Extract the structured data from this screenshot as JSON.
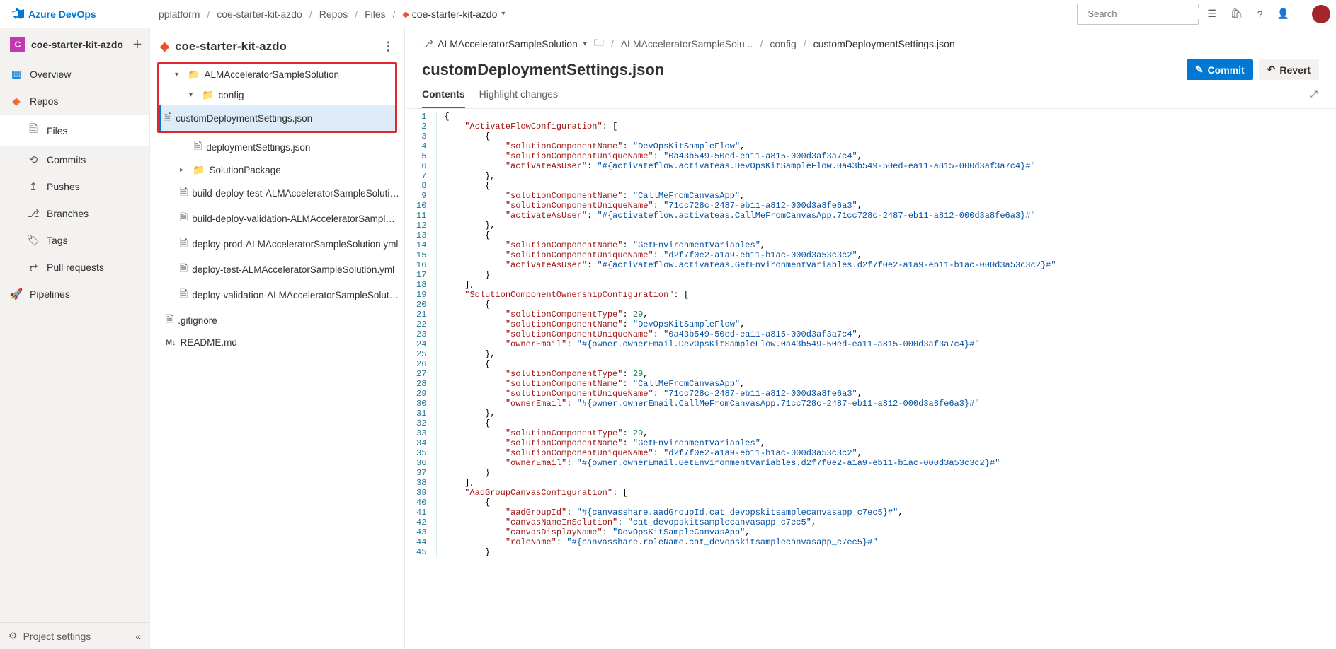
{
  "header": {
    "product": "Azure DevOps",
    "breadcrumbs": [
      "pplatform",
      "coe-starter-kit-azdo",
      "Repos",
      "Files",
      "coe-starter-kit-azdo"
    ],
    "search_placeholder": "Search"
  },
  "leftnav": {
    "project_badge": "C",
    "project_name": "coe-starter-kit-azdo",
    "items": [
      {
        "label": "Overview"
      },
      {
        "label": "Repos"
      },
      {
        "label": "Files",
        "sub": true,
        "selected": true
      },
      {
        "label": "Commits",
        "sub": true
      },
      {
        "label": "Pushes",
        "sub": true
      },
      {
        "label": "Branches",
        "sub": true
      },
      {
        "label": "Tags",
        "sub": true
      },
      {
        "label": "Pull requests",
        "sub": true
      },
      {
        "label": "Pipelines"
      }
    ],
    "settings": "Project settings"
  },
  "tree": {
    "repo": "coe-starter-kit-azdo",
    "folder1": "ALMAcceleratorSampleSolution",
    "folder2": "config",
    "file_selected": "customDeploymentSettings.json",
    "file_b": "deploymentSettings.json",
    "folder3": "SolutionPackage",
    "file_c": "build-deploy-test-ALMAcceleratorSampleSolutio...",
    "file_d": "build-deploy-validation-ALMAcceleratorSampleS...",
    "file_e": "deploy-prod-ALMAcceleratorSampleSolution.yml",
    "file_f": "deploy-test-ALMAcceleratorSampleSolution.yml",
    "file_g": "deploy-validation-ALMAcceleratorSampleSolutio...",
    "file_h": ".gitignore",
    "file_i": "README.md"
  },
  "content": {
    "branch": "ALMAcceleratorSampleSolution",
    "path1": "ALMAcceleratorSampleSolu...",
    "path2": "config",
    "path3": "customDeploymentSettings.json",
    "title": "customDeploymentSettings.json",
    "commit": "Commit",
    "revert": "Revert",
    "tab_contents": "Contents",
    "tab_highlight": "Highlight changes"
  },
  "code_lines": [
    [
      [
        "brace",
        "{"
      ]
    ],
    [
      [
        "sp",
        "    "
      ],
      [
        "key",
        "\"ActivateFlowConfiguration\""
      ],
      [
        "punc",
        ": ["
      ]
    ],
    [
      [
        "sp",
        "        "
      ],
      [
        "brace",
        "{"
      ]
    ],
    [
      [
        "sp",
        "            "
      ],
      [
        "key",
        "\"solutionComponentName\""
      ],
      [
        "punc",
        ": "
      ],
      [
        "str",
        "\"DevOpsKitSampleFlow\""
      ],
      [
        "punc",
        ","
      ]
    ],
    [
      [
        "sp",
        "            "
      ],
      [
        "key",
        "\"solutionComponentUniqueName\""
      ],
      [
        "punc",
        ": "
      ],
      [
        "str",
        "\"0a43b549-50ed-ea11-a815-000d3af3a7c4\""
      ],
      [
        "punc",
        ","
      ]
    ],
    [
      [
        "sp",
        "            "
      ],
      [
        "key",
        "\"activateAsUser\""
      ],
      [
        "punc",
        ": "
      ],
      [
        "str",
        "\"#{activateflow.activateas.DevOpsKitSampleFlow.0a43b549-50ed-ea11-a815-000d3af3a7c4}#\""
      ]
    ],
    [
      [
        "sp",
        "        "
      ],
      [
        "brace",
        "},"
      ]
    ],
    [
      [
        "sp",
        "        "
      ],
      [
        "brace",
        "{"
      ]
    ],
    [
      [
        "sp",
        "            "
      ],
      [
        "key",
        "\"solutionComponentName\""
      ],
      [
        "punc",
        ": "
      ],
      [
        "str",
        "\"CallMeFromCanvasApp\""
      ],
      [
        "punc",
        ","
      ]
    ],
    [
      [
        "sp",
        "            "
      ],
      [
        "key",
        "\"solutionComponentUniqueName\""
      ],
      [
        "punc",
        ": "
      ],
      [
        "str",
        "\"71cc728c-2487-eb11-a812-000d3a8fe6a3\""
      ],
      [
        "punc",
        ","
      ]
    ],
    [
      [
        "sp",
        "            "
      ],
      [
        "key",
        "\"activateAsUser\""
      ],
      [
        "punc",
        ": "
      ],
      [
        "str",
        "\"#{activateflow.activateas.CallMeFromCanvasApp.71cc728c-2487-eb11-a812-000d3a8fe6a3}#\""
      ]
    ],
    [
      [
        "sp",
        "        "
      ],
      [
        "brace",
        "},"
      ]
    ],
    [
      [
        "sp",
        "        "
      ],
      [
        "brace",
        "{"
      ]
    ],
    [
      [
        "sp",
        "            "
      ],
      [
        "key",
        "\"solutionComponentName\""
      ],
      [
        "punc",
        ": "
      ],
      [
        "str",
        "\"GetEnvironmentVariables\""
      ],
      [
        "punc",
        ","
      ]
    ],
    [
      [
        "sp",
        "            "
      ],
      [
        "key",
        "\"solutionComponentUniqueName\""
      ],
      [
        "punc",
        ": "
      ],
      [
        "str",
        "\"d2f7f0e2-a1a9-eb11-b1ac-000d3a53c3c2\""
      ],
      [
        "punc",
        ","
      ]
    ],
    [
      [
        "sp",
        "            "
      ],
      [
        "key",
        "\"activateAsUser\""
      ],
      [
        "punc",
        ": "
      ],
      [
        "str",
        "\"#{activateflow.activateas.GetEnvironmentVariables.d2f7f0e2-a1a9-eb11-b1ac-000d3a53c3c2}#\""
      ]
    ],
    [
      [
        "sp",
        "        "
      ],
      [
        "brace",
        "}"
      ]
    ],
    [
      [
        "sp",
        "    "
      ],
      [
        "punc",
        "],"
      ]
    ],
    [
      [
        "sp",
        "    "
      ],
      [
        "key",
        "\"SolutionComponentOwnershipConfiguration\""
      ],
      [
        "punc",
        ": ["
      ]
    ],
    [
      [
        "sp",
        "        "
      ],
      [
        "brace",
        "{"
      ]
    ],
    [
      [
        "sp",
        "            "
      ],
      [
        "key",
        "\"solutionComponentType\""
      ],
      [
        "punc",
        ": "
      ],
      [
        "num",
        "29"
      ],
      [
        "punc",
        ","
      ]
    ],
    [
      [
        "sp",
        "            "
      ],
      [
        "key",
        "\"solutionComponentName\""
      ],
      [
        "punc",
        ": "
      ],
      [
        "str",
        "\"DevOpsKitSampleFlow\""
      ],
      [
        "punc",
        ","
      ]
    ],
    [
      [
        "sp",
        "            "
      ],
      [
        "key",
        "\"solutionComponentUniqueName\""
      ],
      [
        "punc",
        ": "
      ],
      [
        "str",
        "\"0a43b549-50ed-ea11-a815-000d3af3a7c4\""
      ],
      [
        "punc",
        ","
      ]
    ],
    [
      [
        "sp",
        "            "
      ],
      [
        "key",
        "\"ownerEmail\""
      ],
      [
        "punc",
        ": "
      ],
      [
        "str",
        "\"#{owner.ownerEmail.DevOpsKitSampleFlow.0a43b549-50ed-ea11-a815-000d3af3a7c4}#\""
      ]
    ],
    [
      [
        "sp",
        "        "
      ],
      [
        "brace",
        "},"
      ]
    ],
    [
      [
        "sp",
        "        "
      ],
      [
        "brace",
        "{"
      ]
    ],
    [
      [
        "sp",
        "            "
      ],
      [
        "key",
        "\"solutionComponentType\""
      ],
      [
        "punc",
        ": "
      ],
      [
        "num",
        "29"
      ],
      [
        "punc",
        ","
      ]
    ],
    [
      [
        "sp",
        "            "
      ],
      [
        "key",
        "\"solutionComponentName\""
      ],
      [
        "punc",
        ": "
      ],
      [
        "str",
        "\"CallMeFromCanvasApp\""
      ],
      [
        "punc",
        ","
      ]
    ],
    [
      [
        "sp",
        "            "
      ],
      [
        "key",
        "\"solutionComponentUniqueName\""
      ],
      [
        "punc",
        ": "
      ],
      [
        "str",
        "\"71cc728c-2487-eb11-a812-000d3a8fe6a3\""
      ],
      [
        "punc",
        ","
      ]
    ],
    [
      [
        "sp",
        "            "
      ],
      [
        "key",
        "\"ownerEmail\""
      ],
      [
        "punc",
        ": "
      ],
      [
        "str",
        "\"#{owner.ownerEmail.CallMeFromCanvasApp.71cc728c-2487-eb11-a812-000d3a8fe6a3}#\""
      ]
    ],
    [
      [
        "sp",
        "        "
      ],
      [
        "brace",
        "},"
      ]
    ],
    [
      [
        "sp",
        "        "
      ],
      [
        "brace",
        "{"
      ]
    ],
    [
      [
        "sp",
        "            "
      ],
      [
        "key",
        "\"solutionComponentType\""
      ],
      [
        "punc",
        ": "
      ],
      [
        "num",
        "29"
      ],
      [
        "punc",
        ","
      ]
    ],
    [
      [
        "sp",
        "            "
      ],
      [
        "key",
        "\"solutionComponentName\""
      ],
      [
        "punc",
        ": "
      ],
      [
        "str",
        "\"GetEnvironmentVariables\""
      ],
      [
        "punc",
        ","
      ]
    ],
    [
      [
        "sp",
        "            "
      ],
      [
        "key",
        "\"solutionComponentUniqueName\""
      ],
      [
        "punc",
        ": "
      ],
      [
        "str",
        "\"d2f7f0e2-a1a9-eb11-b1ac-000d3a53c3c2\""
      ],
      [
        "punc",
        ","
      ]
    ],
    [
      [
        "sp",
        "            "
      ],
      [
        "key",
        "\"ownerEmail\""
      ],
      [
        "punc",
        ": "
      ],
      [
        "str",
        "\"#{owner.ownerEmail.GetEnvironmentVariables.d2f7f0e2-a1a9-eb11-b1ac-000d3a53c3c2}#\""
      ]
    ],
    [
      [
        "sp",
        "        "
      ],
      [
        "brace",
        "}"
      ]
    ],
    [
      [
        "sp",
        "    "
      ],
      [
        "punc",
        "],"
      ]
    ],
    [
      [
        "sp",
        "    "
      ],
      [
        "key",
        "\"AadGroupCanvasConfiguration\""
      ],
      [
        "punc",
        ": ["
      ]
    ],
    [
      [
        "sp",
        "        "
      ],
      [
        "brace",
        "{"
      ]
    ],
    [
      [
        "sp",
        "            "
      ],
      [
        "key",
        "\"aadGroupId\""
      ],
      [
        "punc",
        ": "
      ],
      [
        "str",
        "\"#{canvasshare.aadGroupId.cat_devopskitsamplecanvasapp_c7ec5}#\""
      ],
      [
        "punc",
        ","
      ]
    ],
    [
      [
        "sp",
        "            "
      ],
      [
        "key",
        "\"canvasNameInSolution\""
      ],
      [
        "punc",
        ": "
      ],
      [
        "str",
        "\"cat_devopskitsamplecanvasapp_c7ec5\""
      ],
      [
        "punc",
        ","
      ]
    ],
    [
      [
        "sp",
        "            "
      ],
      [
        "key",
        "\"canvasDisplayName\""
      ],
      [
        "punc",
        ": "
      ],
      [
        "str",
        "\"DevOpsKitSampleCanvasApp\""
      ],
      [
        "punc",
        ","
      ]
    ],
    [
      [
        "sp",
        "            "
      ],
      [
        "key",
        "\"roleName\""
      ],
      [
        "punc",
        ": "
      ],
      [
        "str",
        "\"#{canvasshare.roleName.cat_devopskitsamplecanvasapp_c7ec5}#\""
      ]
    ],
    [
      [
        "sp",
        "        "
      ],
      [
        "brace",
        "}"
      ]
    ]
  ]
}
